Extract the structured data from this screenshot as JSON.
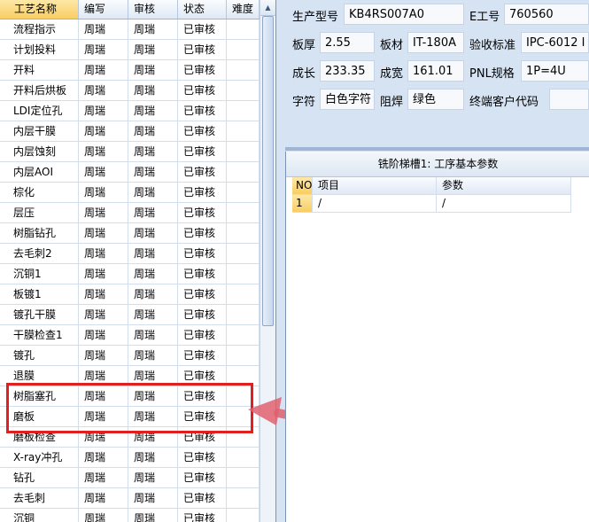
{
  "grid": {
    "columns": [
      "工艺名称",
      "编写",
      "审核",
      "状态",
      "难度"
    ],
    "rows": [
      [
        "流程指示",
        "周瑞",
        "周瑞",
        "已审核",
        ""
      ],
      [
        "计划投料",
        "周瑞",
        "周瑞",
        "已审核",
        ""
      ],
      [
        "开料",
        "周瑞",
        "周瑞",
        "已审核",
        ""
      ],
      [
        "开料后烘板",
        "周瑞",
        "周瑞",
        "已审核",
        ""
      ],
      [
        "LDI定位孔",
        "周瑞",
        "周瑞",
        "已审核",
        ""
      ],
      [
        "内层干膜",
        "周瑞",
        "周瑞",
        "已审核",
        ""
      ],
      [
        "内层蚀刻",
        "周瑞",
        "周瑞",
        "已审核",
        ""
      ],
      [
        "内层AOI",
        "周瑞",
        "周瑞",
        "已审核",
        ""
      ],
      [
        "棕化",
        "周瑞",
        "周瑞",
        "已审核",
        ""
      ],
      [
        "层压",
        "周瑞",
        "周瑞",
        "已审核",
        ""
      ],
      [
        "树脂钻孔",
        "周瑞",
        "周瑞",
        "已审核",
        ""
      ],
      [
        "去毛刺2",
        "周瑞",
        "周瑞",
        "已审核",
        ""
      ],
      [
        "沉铜1",
        "周瑞",
        "周瑞",
        "已审核",
        ""
      ],
      [
        "板镀1",
        "周瑞",
        "周瑞",
        "已审核",
        ""
      ],
      [
        "镀孔干膜",
        "周瑞",
        "周瑞",
        "已审核",
        ""
      ],
      [
        "干膜检查1",
        "周瑞",
        "周瑞",
        "已审核",
        ""
      ],
      [
        "镀孔",
        "周瑞",
        "周瑞",
        "已审核",
        ""
      ],
      [
        "退膜",
        "周瑞",
        "周瑞",
        "已审核",
        ""
      ],
      [
        "树脂塞孔",
        "周瑞",
        "周瑞",
        "已审核",
        ""
      ],
      [
        "磨板",
        "周瑞",
        "周瑞",
        "已审核",
        ""
      ],
      [
        "磨板检查",
        "周瑞",
        "周瑞",
        "已审核",
        ""
      ],
      [
        "X-ray冲孔",
        "周瑞",
        "周瑞",
        "已审核",
        ""
      ],
      [
        "钻孔",
        "周瑞",
        "周瑞",
        "已审核",
        ""
      ],
      [
        "去毛刺",
        "周瑞",
        "周瑞",
        "已审核",
        ""
      ],
      [
        "沉铜",
        "周瑞",
        "周瑞",
        "已审核",
        ""
      ]
    ]
  },
  "form": {
    "model_label": "生产型号",
    "model_value": "KB4RS007A0",
    "engineer_label": "E工号",
    "engineer_value": "760560",
    "thickness_label": "板厚",
    "thickness_value": "2.55",
    "material_label": "板材",
    "material_value": "IT-180A",
    "standard_label": "验收标准",
    "standard_value": "IPC-6012 I",
    "length_label": "成长",
    "length_value": "233.35",
    "width_label": "成宽",
    "width_value": "161.01",
    "pnl_label": "PNL规格",
    "pnl_value": "1P=4U",
    "char_label": "字符",
    "char_value": "白色字符",
    "mask_label": "阻焊",
    "mask_value": "绿色",
    "customer_label": "终端客户代码",
    "customer_value": ""
  },
  "panel": {
    "title": "铣阶梯槽1: 工序基本参数",
    "columns": [
      "NO",
      "项目",
      "参数"
    ],
    "rows": [
      [
        "1",
        "/",
        "/"
      ]
    ]
  },
  "colors": {
    "highlight": "#e02020",
    "arrow": "#e0606e",
    "selected_header": "#f9cd63"
  }
}
